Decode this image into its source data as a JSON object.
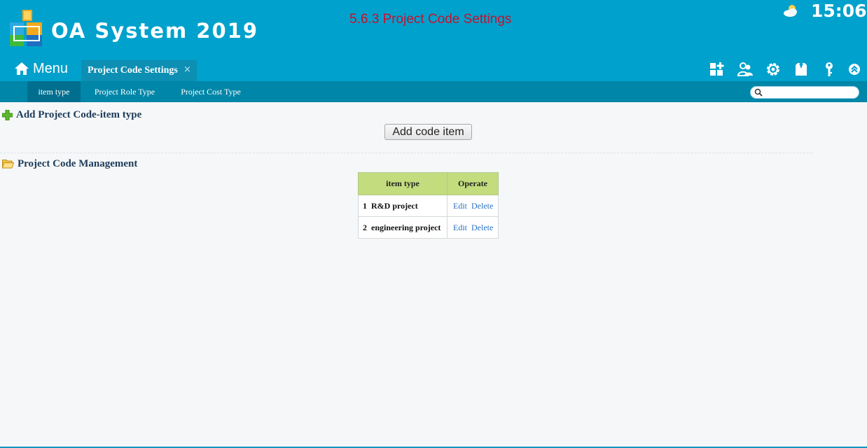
{
  "header": {
    "app_title": "OA System 2019",
    "page_heading": "5.6.3 Project Code Settings",
    "clock": "15:06",
    "weather_icon": "partly-cloudy-icon",
    "menu_label": "Menu",
    "active_tab": {
      "label": "Project Code Settings",
      "close": "×"
    },
    "toolbar_icons": [
      "dashboard-add-icon",
      "user-group-icon",
      "gear-icon",
      "shirt-icon",
      "key-icon",
      "collapse-up-icon"
    ]
  },
  "subnav": {
    "items": [
      {
        "label": "item type",
        "active": true
      },
      {
        "label": "Project Role Type",
        "active": false
      },
      {
        "label": "Project Cost Type",
        "active": false
      }
    ],
    "search_value": ""
  },
  "add_section": {
    "title": "Add Project Code-item type",
    "button_label": "Add code item"
  },
  "manage_section": {
    "title": "Project Code Management",
    "table": {
      "headers": [
        "item type",
        "Operate"
      ],
      "rows": [
        {
          "index": "1",
          "name": "R&D project",
          "edit": "Edit",
          "delete": "Delete"
        },
        {
          "index": "2",
          "name": "engineering project",
          "edit": "Edit",
          "delete": "Delete"
        }
      ]
    }
  },
  "colors": {
    "header_bg": "#00a1cc",
    "subnav_bg": "#0086a8",
    "heading_red": "#c8102e",
    "table_header_bg": "#c3dd7e",
    "link_blue": "#2a70c0"
  }
}
